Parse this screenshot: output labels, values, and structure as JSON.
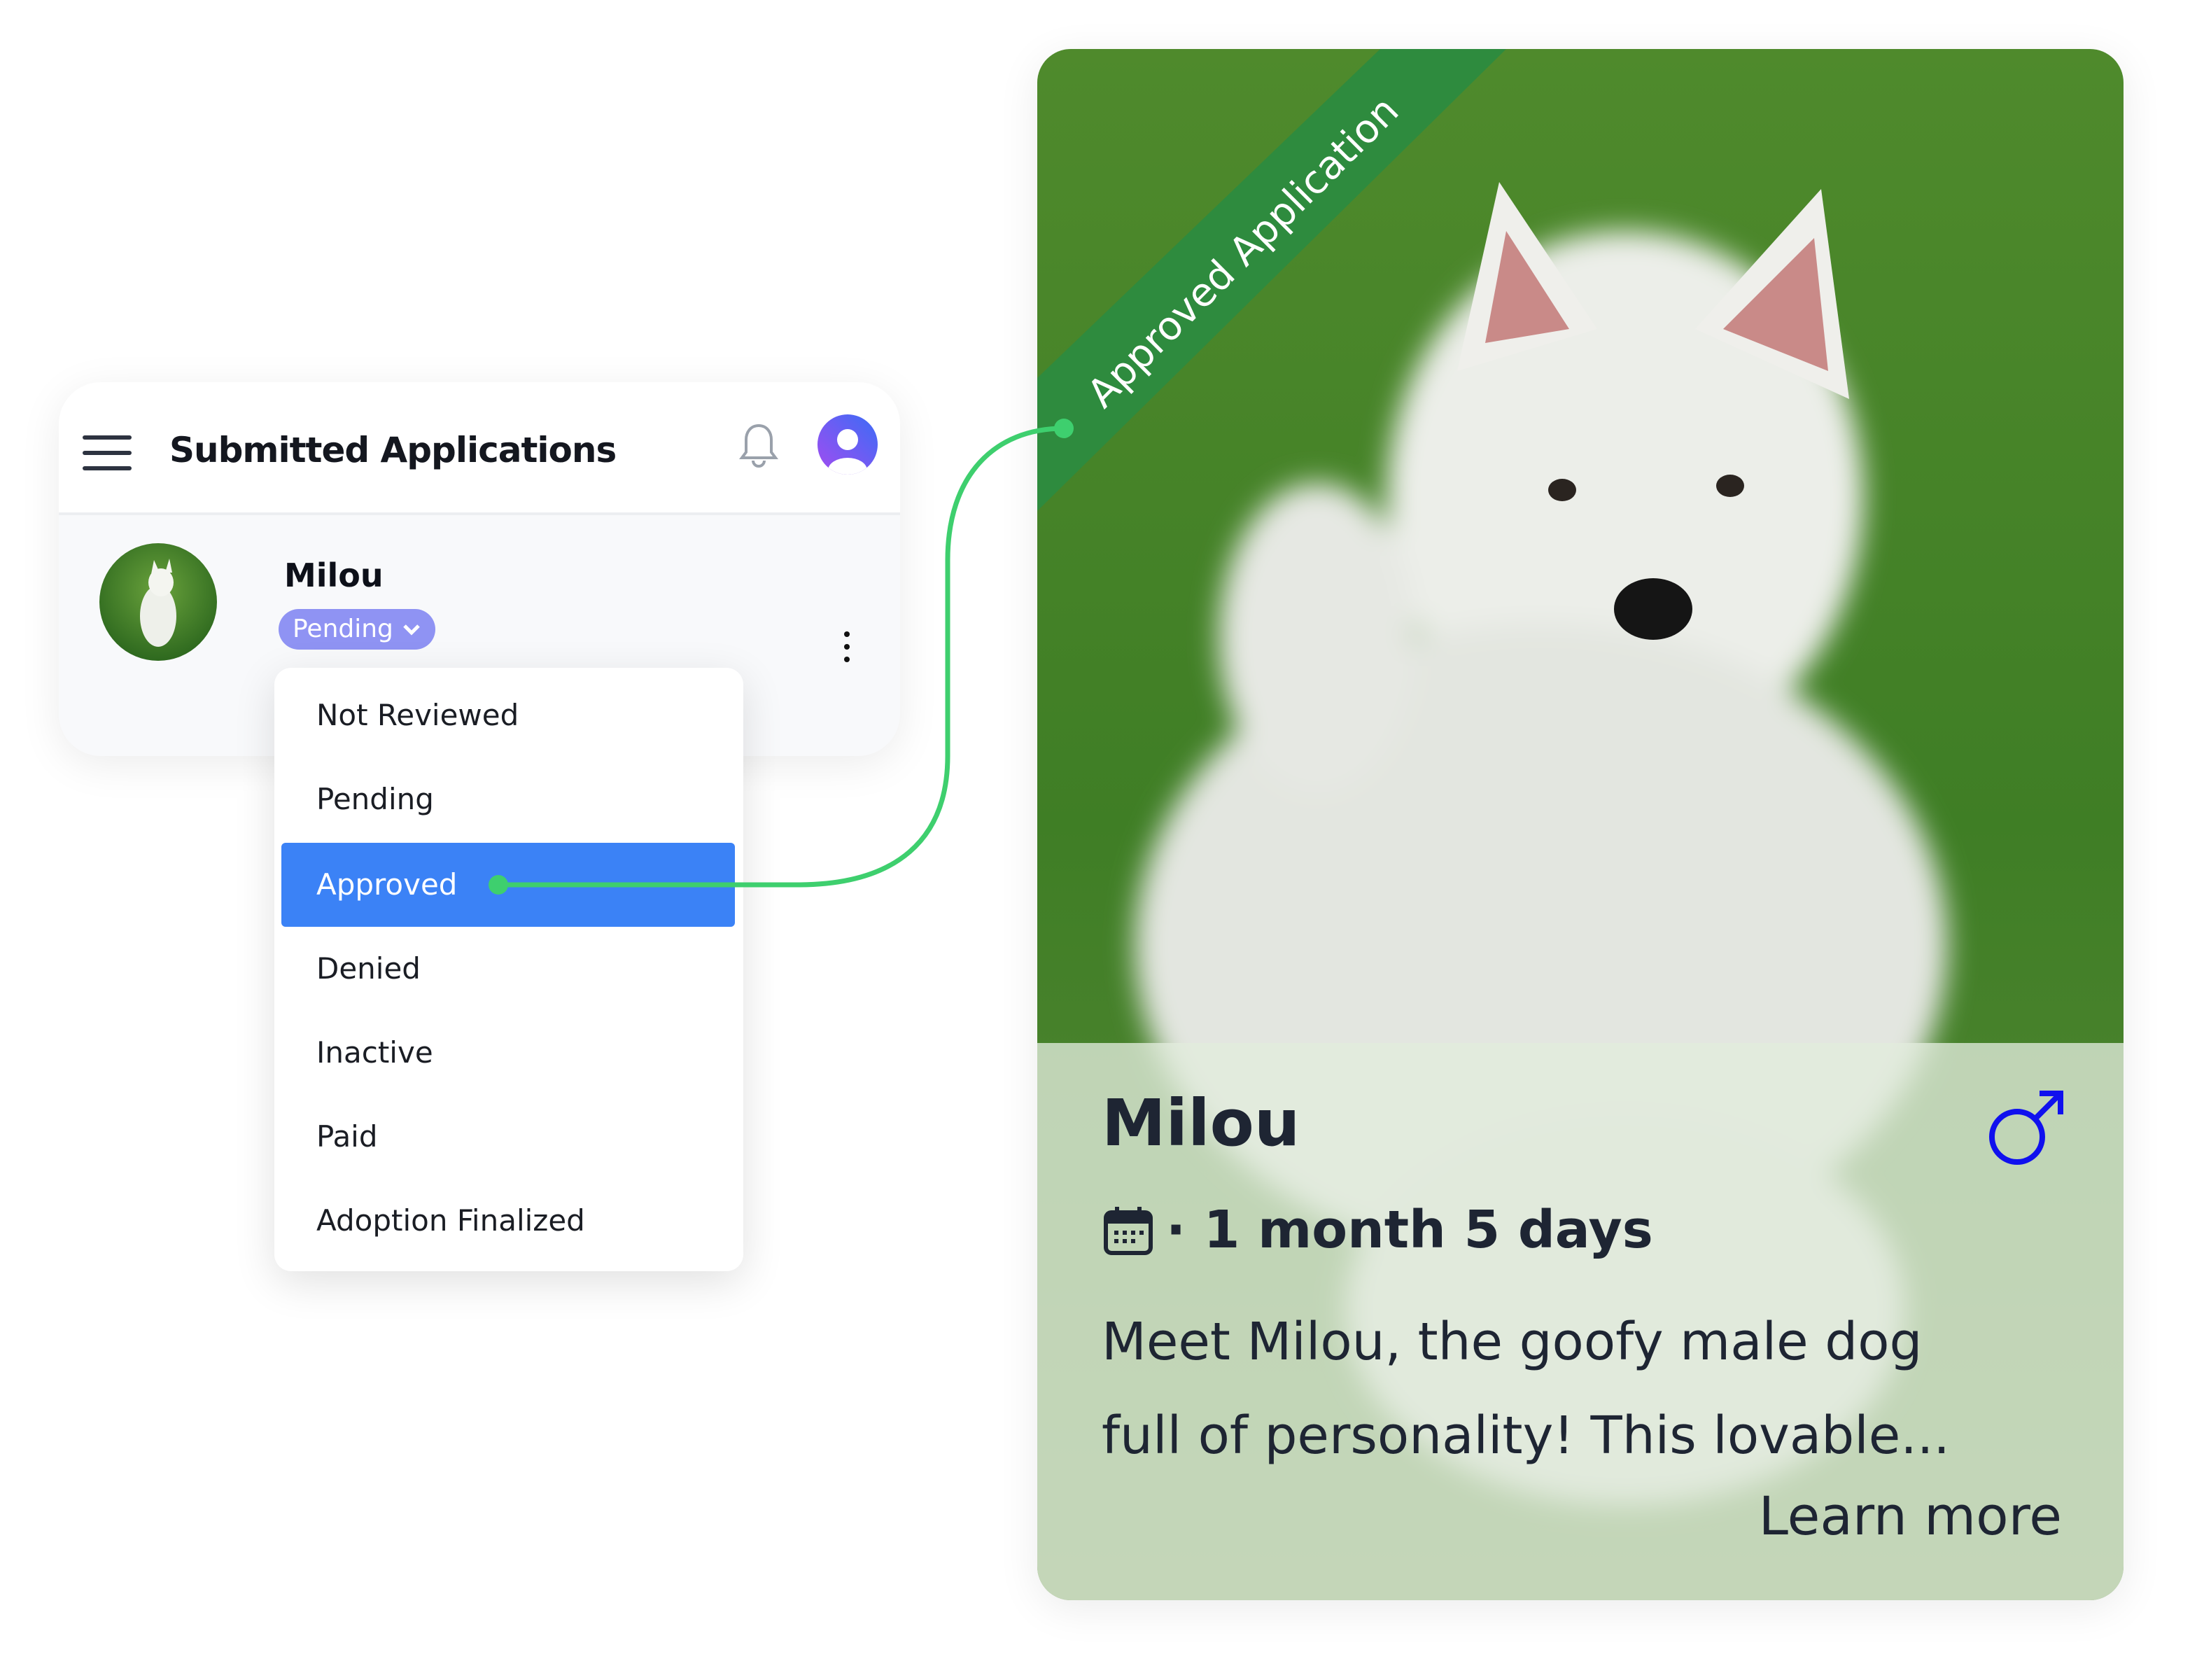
{
  "header": {
    "title": "Submitted Applications",
    "icons": [
      "menu-icon",
      "bell-icon",
      "user-avatar-icon"
    ]
  },
  "application": {
    "name": "Milou",
    "status": "Pending"
  },
  "status_menu": {
    "items": [
      "Not Reviewed",
      "Pending",
      "Approved",
      "Denied",
      "Inactive",
      "Paid",
      "Adoption Finalized"
    ],
    "selected": "Approved"
  },
  "pet_card": {
    "ribbon": "Approved Application",
    "name": "Milou",
    "gender": "male",
    "age": "· 1 month 5 days",
    "description_line1": "Meet Milou, the goofy male dog",
    "description_line2": "full of personality! This lovable...",
    "cta": "Learn more"
  },
  "colors": {
    "accent": "#3b82f6",
    "pill": "#8f93f3",
    "connector": "#3ecf6e",
    "ribbon": "#2e8b3e",
    "male": "#1010ee"
  }
}
